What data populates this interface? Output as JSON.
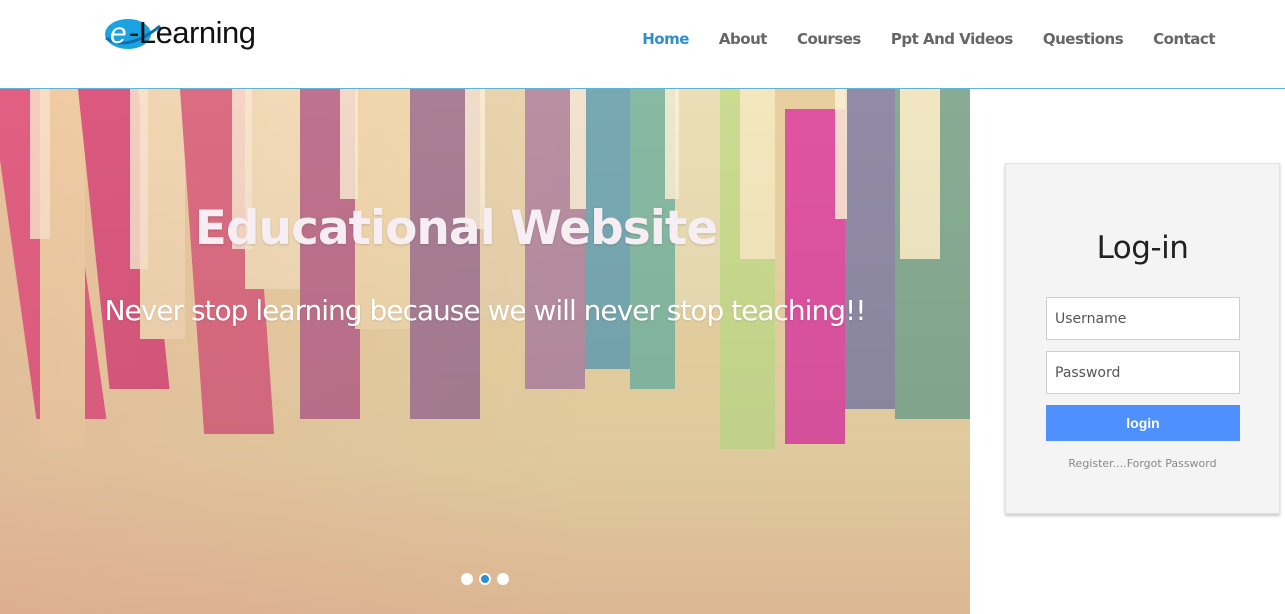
{
  "brand": {
    "logo_letter": "e",
    "logo_text": "-Learning",
    "logo_color": "#1aa3e0"
  },
  "nav": {
    "items": [
      {
        "label": "Home",
        "active": true
      },
      {
        "label": "About"
      },
      {
        "label": "Courses"
      },
      {
        "label": "Ppt And Videos"
      },
      {
        "label": "Questions"
      },
      {
        "label": "Contact"
      }
    ],
    "active_color": "#2e8fce"
  },
  "hero": {
    "title": "Educational Website",
    "subtitle": "Never stop learning because we will never stop teaching!!",
    "slide_count": 3,
    "active_slide": 2
  },
  "login": {
    "title": "Log-in",
    "username_placeholder": "Username",
    "password_placeholder": "Password",
    "button_label": "login",
    "button_color": "#4d90fe",
    "register_link": "Register",
    "separator": "....",
    "forgot_link": "Forgot Password"
  }
}
